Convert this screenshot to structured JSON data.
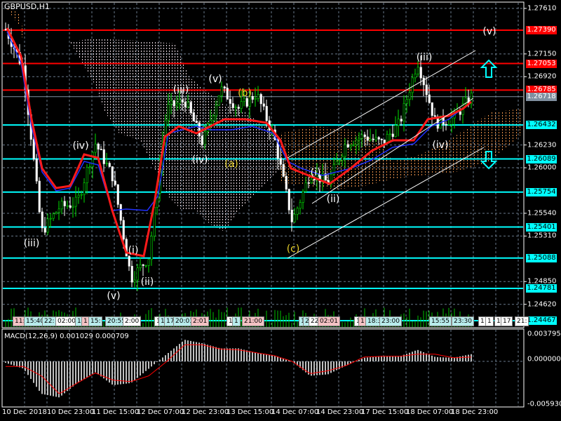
{
  "window": {
    "title": "GBPUSD,H1"
  },
  "colors": {
    "bg": "#000000",
    "grid": "#6a7a8c",
    "candle_up": "#00e000",
    "candle_down": "#ffffff",
    "resistance": "#ff0000",
    "support": "#00ffff",
    "ma_red": "#ff1a1a",
    "ma_blue": "#2030ff",
    "cloud_white": "#e8d8e0",
    "cloud_orange": "#e8914a",
    "macd_hist": "#c0c0c0",
    "macd_signal": "#ff0000"
  },
  "price_axis": {
    "ticks": [
      "1.27610",
      "1.27150",
      "1.26920",
      "1.26230",
      "1.26000",
      "1.25540",
      "1.25310",
      "1.24850",
      "1.24620"
    ]
  },
  "levels": [
    {
      "price": "1.27390",
      "kind": "resistance"
    },
    {
      "price": "1.27053",
      "kind": "resistance"
    },
    {
      "price": "1.26785",
      "kind": "resistance"
    },
    {
      "price": "1.26718",
      "kind": "current"
    },
    {
      "price": "1.26432",
      "kind": "support"
    },
    {
      "price": "1.26089",
      "kind": "support"
    },
    {
      "price": "1.25754",
      "kind": "support"
    },
    {
      "price": "1.25401",
      "kind": "support"
    },
    {
      "price": "1.25088",
      "kind": "support"
    },
    {
      "price": "1.24781",
      "kind": "support"
    },
    {
      "price": "1.24467",
      "kind": "support"
    }
  ],
  "time_axis": [
    "10 Dec 2018",
    "10 Dec 23:00",
    "11 Dec 15:00",
    "12 Dec 07:00",
    "12 Dec 23:00",
    "13 Dec 15:00",
    "14 Dec 07:00",
    "14 Dec 23:00",
    "17 Dec 15:00",
    "18 Dec 07:00",
    "18 Dec 23:00"
  ],
  "wave_labels": [
    "(v)",
    "(iii)",
    "(v)",
    "(iii)",
    "(b)",
    "(iv)",
    "(iv)",
    "(a)",
    "(i)",
    "(ii)",
    "(iv)",
    "(iii)",
    "(c)",
    "(i)",
    "(ii)",
    "(v)"
  ],
  "volume_labels": [
    {
      "t": "11:",
      "k": "p"
    },
    {
      "t": "15:40",
      "k": "c"
    },
    {
      "t": "22:",
      "k": "c"
    },
    {
      "t": "02:00",
      "k": "w"
    },
    {
      "t": "1",
      "k": "c"
    },
    {
      "t": "1",
      "k": "p"
    },
    {
      "t": "15:",
      "k": "c"
    },
    {
      "t": "20:55",
      "k": "c"
    },
    {
      "t": "2:00",
      "k": "w"
    },
    {
      "t": "1",
      "k": "w"
    },
    {
      "t": "1",
      "k": "c"
    },
    {
      "t": "17",
      "k": "c"
    },
    {
      "t": "20:03",
      "k": "c"
    },
    {
      "t": "2:01",
      "k": "p"
    },
    {
      "t": "1",
      "k": "w"
    },
    {
      "t": "1",
      "k": "c"
    },
    {
      "t": "21:00",
      "k": "p"
    },
    {
      "t": "17",
      "k": "c"
    },
    {
      "t": "2",
      "k": "c"
    },
    {
      "t": "22:",
      "k": "w"
    },
    {
      "t": "02:01",
      "k": "p"
    },
    {
      "t": "1",
      "k": "w"
    },
    {
      "t": "1",
      "k": "p"
    },
    {
      "t": "18:3",
      "k": "c"
    },
    {
      "t": "23:00",
      "k": "c"
    },
    {
      "t": "15:55",
      "k": "c"
    },
    {
      "t": "23:30",
      "k": "c"
    },
    {
      "t": "1",
      "k": "w"
    },
    {
      "t": "1",
      "k": "w"
    },
    {
      "t": "1",
      "k": "w"
    },
    {
      "t": "17",
      "k": "w"
    },
    {
      "t": "21:",
      "k": "w"
    }
  ],
  "macd": {
    "label": "MACD(12,26,9) 0.001029 0.000709",
    "ticks": [
      "0.003795",
      "0.000000",
      "-0.005930"
    ],
    "max": 0.003795,
    "min": -0.00593
  },
  "chart_data": {
    "type": "candlestick",
    "symbol": "GBPUSD",
    "timeframe": "H1",
    "ylim": [
      1.244,
      1.2765
    ],
    "close_path": [
      1.274,
      1.27,
      1.2535,
      1.256,
      1.2565,
      1.2625,
      1.259,
      1.2488,
      1.251,
      1.266,
      1.2668,
      1.2625,
      1.268,
      1.266,
      1.2675,
      1.263,
      1.2545,
      1.2595,
      1.2585,
      1.2625,
      1.2632,
      1.2625,
      1.2645,
      1.2708,
      1.2645,
      1.265,
      1.2672
    ],
    "macd_hist_path": [
      -0.0002,
      -0.001,
      -0.0045,
      -0.005,
      -0.003,
      -0.0015,
      -0.0033,
      -0.003,
      -0.001,
      0.001,
      0.003,
      0.0025,
      0.0018,
      0.0018,
      0.0012,
      0.0008,
      0.0,
      -0.002,
      -0.0018,
      -0.0006,
      0.0005,
      0.0007,
      0.0007,
      0.0016,
      0.0006,
      0.0005,
      0.001
    ],
    "macd_signal_path": [
      -0.0007,
      -0.0007,
      -0.002,
      -0.0045,
      -0.003,
      -0.0016,
      -0.0026,
      -0.0028,
      -0.002,
      0.0,
      0.0023,
      0.0023,
      0.0017,
      0.0016,
      0.0012,
      0.0008,
      0.0,
      -0.0017,
      -0.0013,
      -0.0006,
      0.0006,
      0.0007,
      0.0007,
      0.001,
      0.001,
      0.0005,
      0.0006
    ]
  }
}
